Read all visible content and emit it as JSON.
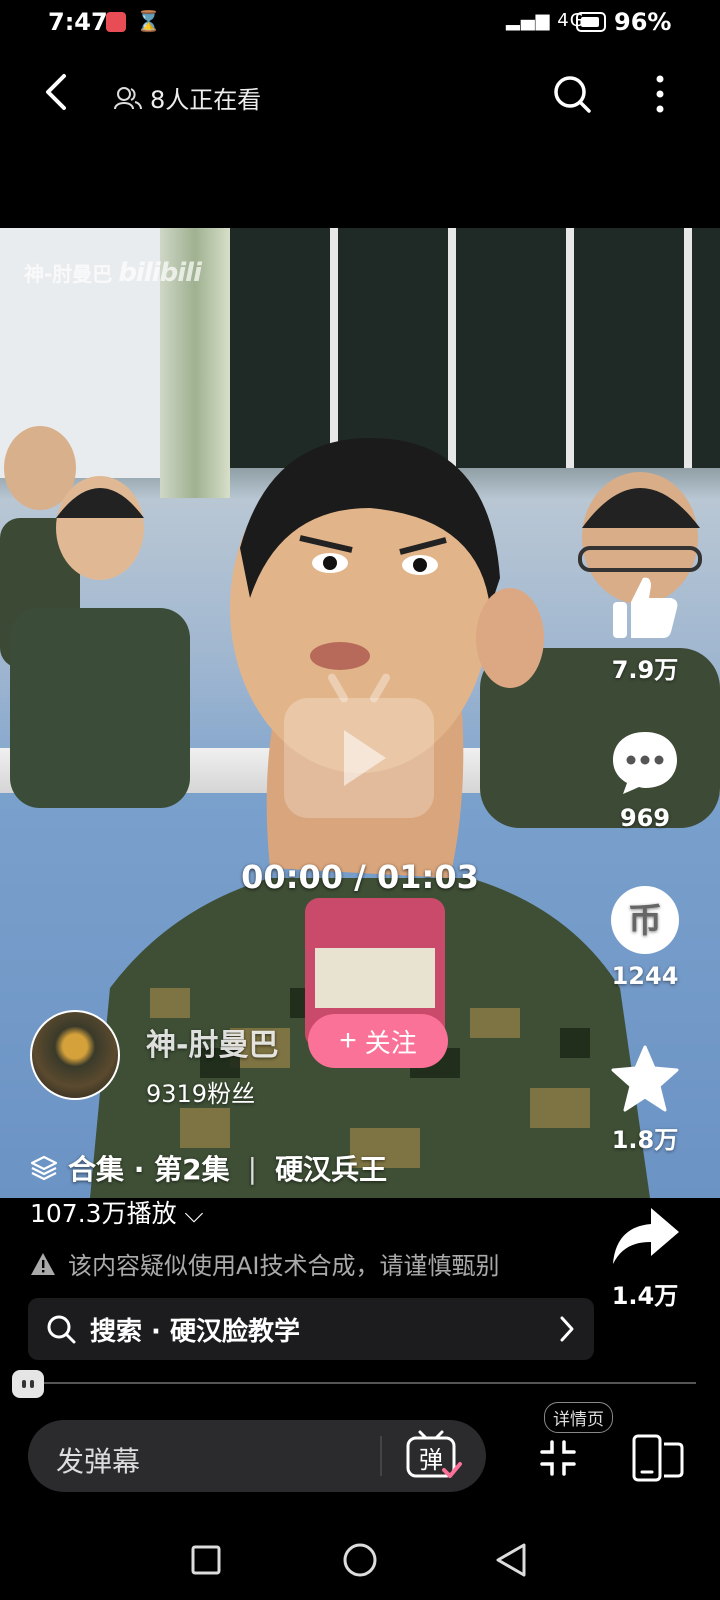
{
  "status_bar": {
    "time": "7:47",
    "battery": "96%",
    "signal": "4G"
  },
  "header": {
    "viewers": "8人正在看"
  },
  "video": {
    "watermark_name": "神-肘曼巴",
    "watermark_brand": "bilibili",
    "timecode": "00:00 / 01:03"
  },
  "actions": {
    "like_count": "7.9万",
    "comment_count": "969",
    "coin_count": "1244",
    "coin_glyph": "币",
    "fav_count": "1.8万",
    "share_count": "1.4万"
  },
  "author": {
    "name": "神-肘曼巴",
    "fans": "9319粉丝",
    "follow_label": "关注"
  },
  "collection": {
    "label": "合集 · 第2集",
    "title": "硬汉兵王"
  },
  "plays": "107.3万播放",
  "ai_notice": "该内容疑似使用AI技术合成，请谨慎甄别",
  "search": {
    "label": "搜索 · 硬汉脸教学"
  },
  "bottom": {
    "danmaku_placeholder": "发弹幕",
    "danmaku_toggle": "弹",
    "detail_tag": "详情页"
  }
}
